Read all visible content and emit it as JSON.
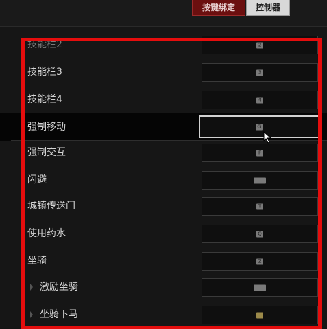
{
  "tabs": {
    "active": "按键绑定",
    "inactive": "控制器"
  },
  "bindings": [
    {
      "label": "技能栏2",
      "key": "2"
    },
    {
      "label": "技能栏3",
      "key": "3"
    },
    {
      "label": "技能栏4",
      "key": "4"
    },
    {
      "label": "强制移动",
      "key": "G"
    },
    {
      "label": "强制交互",
      "key": "F"
    },
    {
      "label": "闪避",
      "key": "space-key-icon"
    },
    {
      "label": "城镇传送门",
      "key": "T"
    },
    {
      "label": "使用药水",
      "key": "Q"
    },
    {
      "label": "坐骑",
      "key": "Z"
    },
    {
      "label": "激励坐骑",
      "key": "space-key-icon"
    },
    {
      "label": "坐骑下马",
      "key": "mouse-key-icon"
    }
  ],
  "colors": {
    "highlight": "#e50d0d",
    "tab_active": "#6b0f0f"
  }
}
